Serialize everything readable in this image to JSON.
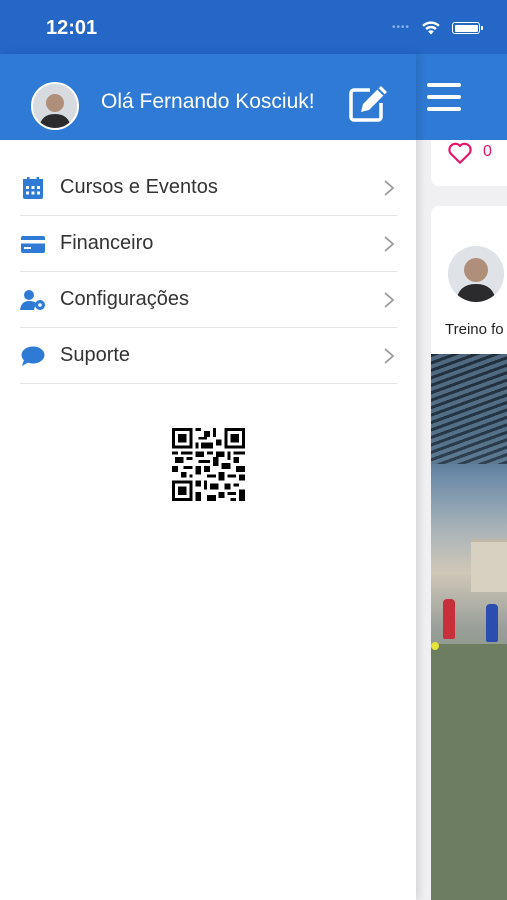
{
  "status_bar": {
    "time": "12:01",
    "signal_dots": "••••"
  },
  "drawer": {
    "greeting": "Olá Fernando Kosciuk!",
    "menu": [
      {
        "label": "Cursos e Eventos",
        "icon": "calendar-icon"
      },
      {
        "label": "Financeiro",
        "icon": "credit-card-icon"
      },
      {
        "label": "Configurações",
        "icon": "user-settings-icon"
      },
      {
        "label": "Suporte",
        "icon": "chat-bubble-icon"
      }
    ]
  },
  "feed": {
    "like_count": "0",
    "post_text": "Treino fo"
  },
  "colors": {
    "status_bar": "#2467c6",
    "header": "#2f7ad4",
    "icon_blue": "#2f7ad4",
    "heart": "#e5176b"
  }
}
